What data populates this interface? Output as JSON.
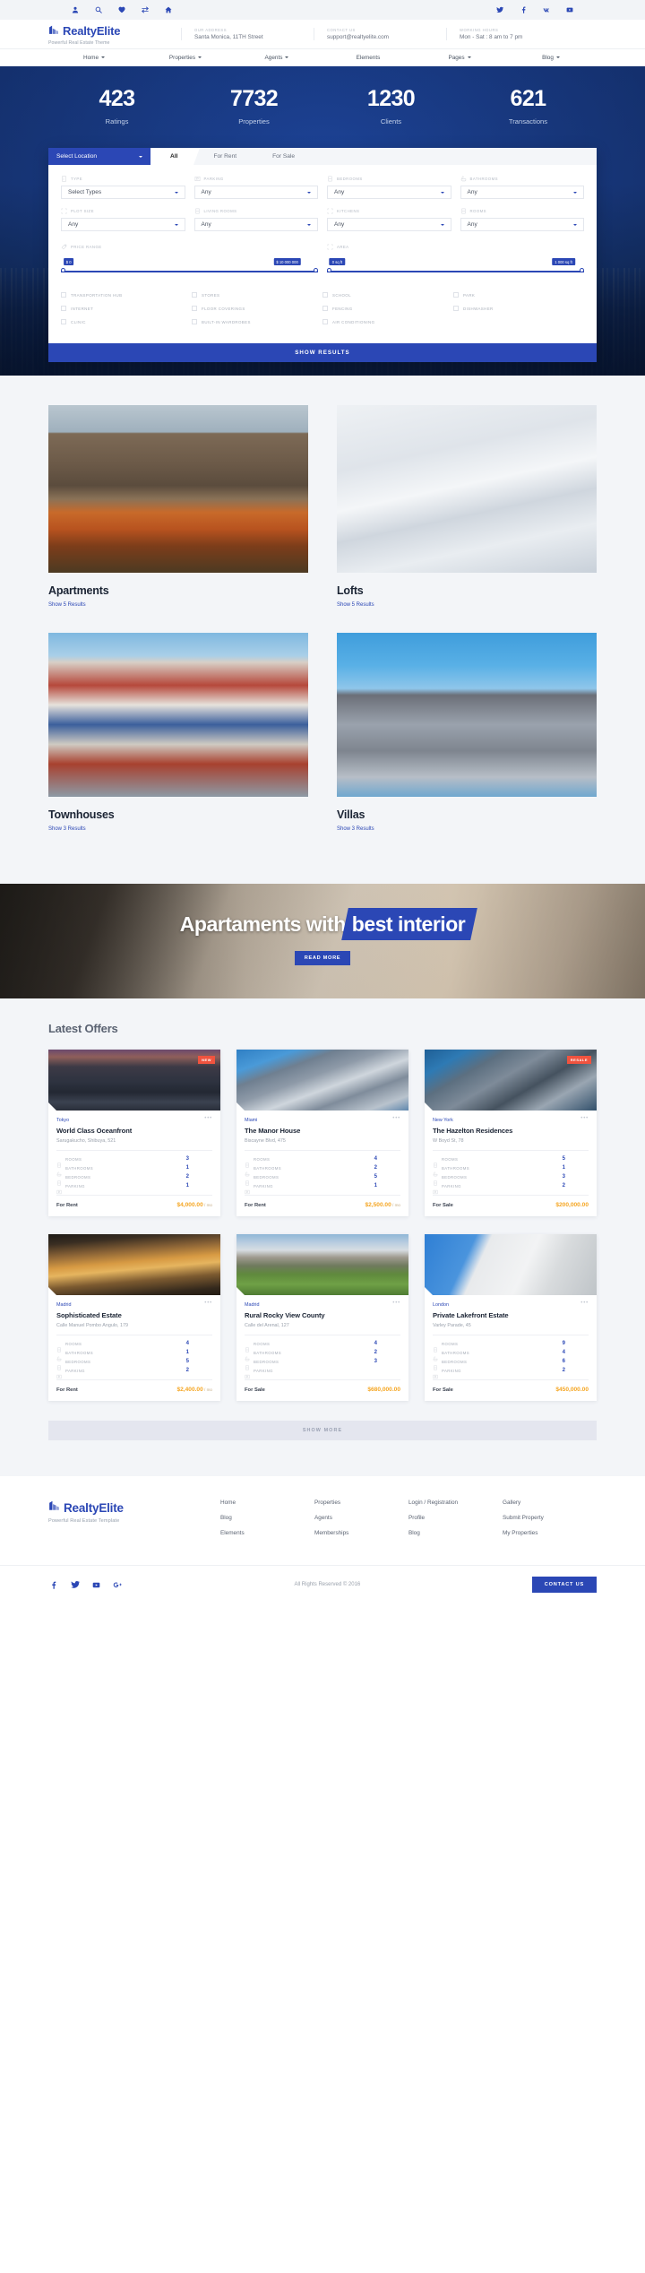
{
  "topbar": {
    "left_icons": [
      "user-icon",
      "search-icon",
      "heart-icon",
      "compare-icon",
      "home-icon"
    ],
    "right_icons": [
      "twitter-icon",
      "facebook-icon",
      "vk-icon",
      "youtube-icon"
    ]
  },
  "header": {
    "brand": "RealtyElite",
    "tagline": "Powerful Real Estate Theme",
    "info": [
      {
        "label": "OUR ADDRESS",
        "value": "Santa Monica, 11TH Street"
      },
      {
        "label": "CONTACT US",
        "value": "support@realtyelite.com"
      },
      {
        "label": "WORKING HOURS",
        "value": "Mon - Sat : 8 am to 7 pm"
      }
    ]
  },
  "nav": [
    {
      "label": "Home",
      "caret": true
    },
    {
      "label": "Properties",
      "caret": true
    },
    {
      "label": "Agents",
      "caret": true
    },
    {
      "label": "Elements",
      "caret": false
    },
    {
      "label": "Pages",
      "caret": true
    },
    {
      "label": "Blog",
      "caret": true
    }
  ],
  "hero": {
    "stats": [
      {
        "number": "423",
        "caption": "Ratings"
      },
      {
        "number": "7732",
        "caption": "Properties"
      },
      {
        "number": "1230",
        "caption": "Clients"
      },
      {
        "number": "621",
        "caption": "Transactions"
      }
    ]
  },
  "search": {
    "location_label": "Select Location",
    "tabs": [
      {
        "label": "All",
        "active": true
      },
      {
        "label": "For Rent",
        "active": false
      },
      {
        "label": "For Sale",
        "active": false
      }
    ],
    "fields_row1": [
      {
        "label": "TYPE",
        "value": "Select Types",
        "icon": "building-icon"
      },
      {
        "label": "PARKING",
        "value": "Any",
        "icon": "parking-icon"
      },
      {
        "label": "BEDROOMS",
        "value": "Any",
        "icon": "bed-icon"
      },
      {
        "label": "BATHROOMS",
        "value": "Any",
        "icon": "bath-icon"
      }
    ],
    "fields_row2": [
      {
        "label": "PLOT SIZE",
        "value": "Any",
        "icon": "area-icon"
      },
      {
        "label": "LIVING ROOMS",
        "value": "Any",
        "icon": "sofa-icon"
      },
      {
        "label": "KITCHENS",
        "value": "Any",
        "icon": "kitchen-icon"
      },
      {
        "label": "ROOMS",
        "value": "Any",
        "icon": "room-icon"
      }
    ],
    "price_range": {
      "label": "PRICE RANGE",
      "icon": "tag-icon",
      "min": "$ 0",
      "max": "$ 10 000 000"
    },
    "area_range": {
      "label": "AREA",
      "icon": "area-icon",
      "min": "0 sq ft",
      "max": "1 000 sq ft"
    },
    "checkboxes": [
      [
        "TRANSPORTATION HUB",
        "STORES",
        "SCHOOL",
        "PARK"
      ],
      [
        "INTERNET",
        "FLOOR COVERINGS",
        "FENCING",
        "DISHWASHER"
      ],
      [
        "CLINIC",
        "BUILT-IN WARDROBES",
        "AIR CONDITIONING",
        ""
      ]
    ],
    "submit_label": "SHOW RESULTS"
  },
  "categories": [
    {
      "title": "Apartments",
      "link": "Show 5 Results",
      "style": "ph-house"
    },
    {
      "title": "Lofts",
      "link": "Show 5 Results",
      "style": "ph-lofts"
    },
    {
      "title": "Townhouses",
      "link": "Show 3 Results",
      "style": "ph-town"
    },
    {
      "title": "Villas",
      "link": "Show 3 Results",
      "style": "ph-villa"
    }
  ],
  "banner": {
    "text_plain": "Apartaments with",
    "text_highlight": "best interior",
    "button": "READ MORE"
  },
  "offers": {
    "title": "Latest Offers",
    "spec_labels": [
      "ROOMS",
      "BATHROOMS",
      "BEDROOMS",
      "PARKING"
    ],
    "show_more": "SHOW MORE",
    "cards": [
      {
        "city": "Tokyo",
        "name": "World Class Oceanfront",
        "address": "Sarugakucho, Shibuya, 521",
        "tag": "NEW",
        "tag_class": "tag-new",
        "rooms": "3",
        "bathrooms": "1",
        "bedrooms": "2",
        "parking": "1",
        "status": "For Rent",
        "price": "$4,000.00",
        "per": " / mo",
        "img": "img-oceanfront"
      },
      {
        "city": "Miami",
        "name": "The Manor House",
        "address": "Biscayne Blvd, 475",
        "tag": "",
        "tag_class": "",
        "rooms": "4",
        "bathrooms": "2",
        "bedrooms": "5",
        "parking": "1",
        "status": "For Rent",
        "price": "$2,500.00",
        "per": " / mo",
        "img": "img-manor"
      },
      {
        "city": "New York",
        "name": "The Hazelton Residences",
        "address": "W Boyd St, 78",
        "tag": "RESALE",
        "tag_class": "tag-resale",
        "rooms": "5",
        "bathrooms": "1",
        "bedrooms": "3",
        "parking": "2",
        "status": "For Sale",
        "price": "$200,000.00",
        "per": "",
        "img": "img-hazelton"
      },
      {
        "city": "Madrid",
        "name": "Sophisticated Estate",
        "address": "Calle Manuel Pombo Angulo, 179",
        "tag": "",
        "tag_class": "",
        "rooms": "4",
        "bathrooms": "1",
        "bedrooms": "5",
        "parking": "2",
        "status": "For Rent",
        "price": "$2,400.00",
        "per": " / mo",
        "img": "img-sophisticated"
      },
      {
        "city": "Madrid",
        "name": "Rural Rocky View County",
        "address": "Calle del Arenal, 127",
        "tag": "",
        "tag_class": "",
        "rooms": "4",
        "bathrooms": "2",
        "bedrooms": "3",
        "parking": "",
        "status": "For Sale",
        "price": "$680,000.00",
        "per": "",
        "img": "img-rural"
      },
      {
        "city": "London",
        "name": "Private Lakefront Estate",
        "address": "Varley Parade, 45",
        "tag": "",
        "tag_class": "",
        "rooms": "9",
        "bathrooms": "4",
        "bedrooms": "6",
        "parking": "2",
        "status": "For Sale",
        "price": "$450,000.00",
        "per": "",
        "img": "img-lakefront"
      }
    ]
  },
  "footer": {
    "brand": "RealtyElite",
    "tagline": "Powerful Real Estate Template",
    "columns": [
      [
        "Home",
        "Blog",
        "Elements"
      ],
      [
        "Properties",
        "Agents",
        "Memberships"
      ],
      [
        "Login / Registration",
        "Profile",
        "Blog"
      ],
      [
        "Gallery",
        "Submit Property",
        "My Properties"
      ]
    ],
    "social": [
      "facebook-icon",
      "twitter-icon",
      "youtube-icon",
      "google-plus-icon"
    ],
    "copyright": "All Rights Reserved © 2016",
    "contact_button": "CONTACT US"
  },
  "colors": {
    "brand_blue": "#2b47b5",
    "price_orange": "#f5a623",
    "tag_red": "#f0533f",
    "panel_bg": "#f3f5f8"
  }
}
